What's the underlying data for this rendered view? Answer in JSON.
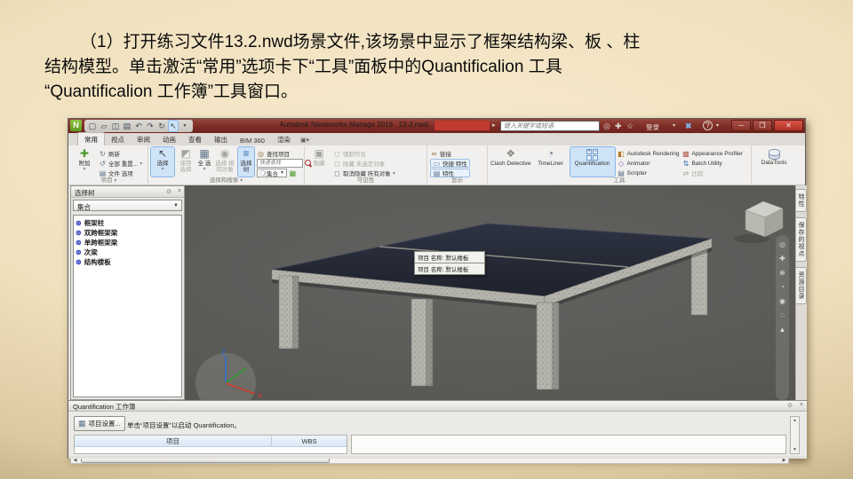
{
  "colors": {
    "titlebar_red": "#7b2a23",
    "accent_blue": "#cfe3f7",
    "highlight_border": "#8ab6e8",
    "viewport_gray": "#5c5c58",
    "slab_dark": "#262a35"
  },
  "slide": {
    "line1": "（1）打开练习文件13.2.nwd场景文件,该场景中显示了框架结构梁、板 、柱",
    "line2": "结构模型。单击激活“常用”选项卡下“工具”面板中的Quantificalion 工具",
    "line3": "“Quantificalion 工作簿”工具窗口。"
  },
  "titlebar": {
    "app_title": "Autodesk Navisworks Manage 2016",
    "doc_name": "13-2.nwd",
    "search_placeholder": "键入关键字或短语",
    "signin_label": "登录",
    "help_label": "?"
  },
  "tabs": {
    "items": [
      "常用",
      "视点",
      "审阅",
      "动画",
      "查看",
      "输出",
      "BIM 360",
      "渲染"
    ]
  },
  "ribbon": {
    "project": {
      "label": "项目",
      "append": "附加",
      "refresh": "刷新",
      "reset_all": "全部 重置...",
      "file_options": "文件 选项"
    },
    "select_search": {
      "label": "选择和搜索",
      "select": "选择",
      "save_selection": "保存 选择",
      "select_all": "全 选",
      "select_same": "选择 相同对象",
      "selection_tree": "选择 树",
      "find_items": "查找项目",
      "quick_find_placeholder": "快速查找",
      "sets": "集合"
    },
    "visibility": {
      "label": "可见性",
      "hide": "隐藏",
      "require": "强制可见",
      "hide_unselected": "隐藏 未选定对象",
      "unhide_all": "取消隐藏 所有对象"
    },
    "display": {
      "label": "显示",
      "links": "链接",
      "quick_properties": "快捷 特性",
      "properties": "特性"
    },
    "tools": {
      "label": "工具",
      "clash": "Clash Detective",
      "timeliner": "TimeLiner",
      "quantification": "Quantification",
      "rendering": "Autodesk Rendering",
      "animator": "Animator",
      "scripter": "Scripter",
      "appearance": "Appearance Profiler",
      "batch": "Batch Utility",
      "compare": "比较",
      "datatools": "DataTools"
    }
  },
  "selection_tree": {
    "title": "选择树",
    "dropdown_value": "集合",
    "items": [
      "框架柱",
      "双跨框架梁",
      "单跨框架梁",
      "次梁",
      "结构楼板"
    ]
  },
  "viewport": {
    "tooltip_lines": [
      "项目 名称: 默认楼板",
      "项目 名称: 默认楼板"
    ],
    "axis_x": "X",
    "axis_z": "Z"
  },
  "right_tabs": {
    "items": [
      "特性",
      "保存的视点",
      "资源目录"
    ]
  },
  "workbook": {
    "title": "Quantification 工作簿",
    "setup_button": "项目设置...",
    "hint": "单击“项目设置”以启动 Quantification。",
    "columns": [
      "项目",
      "WBS"
    ]
  }
}
